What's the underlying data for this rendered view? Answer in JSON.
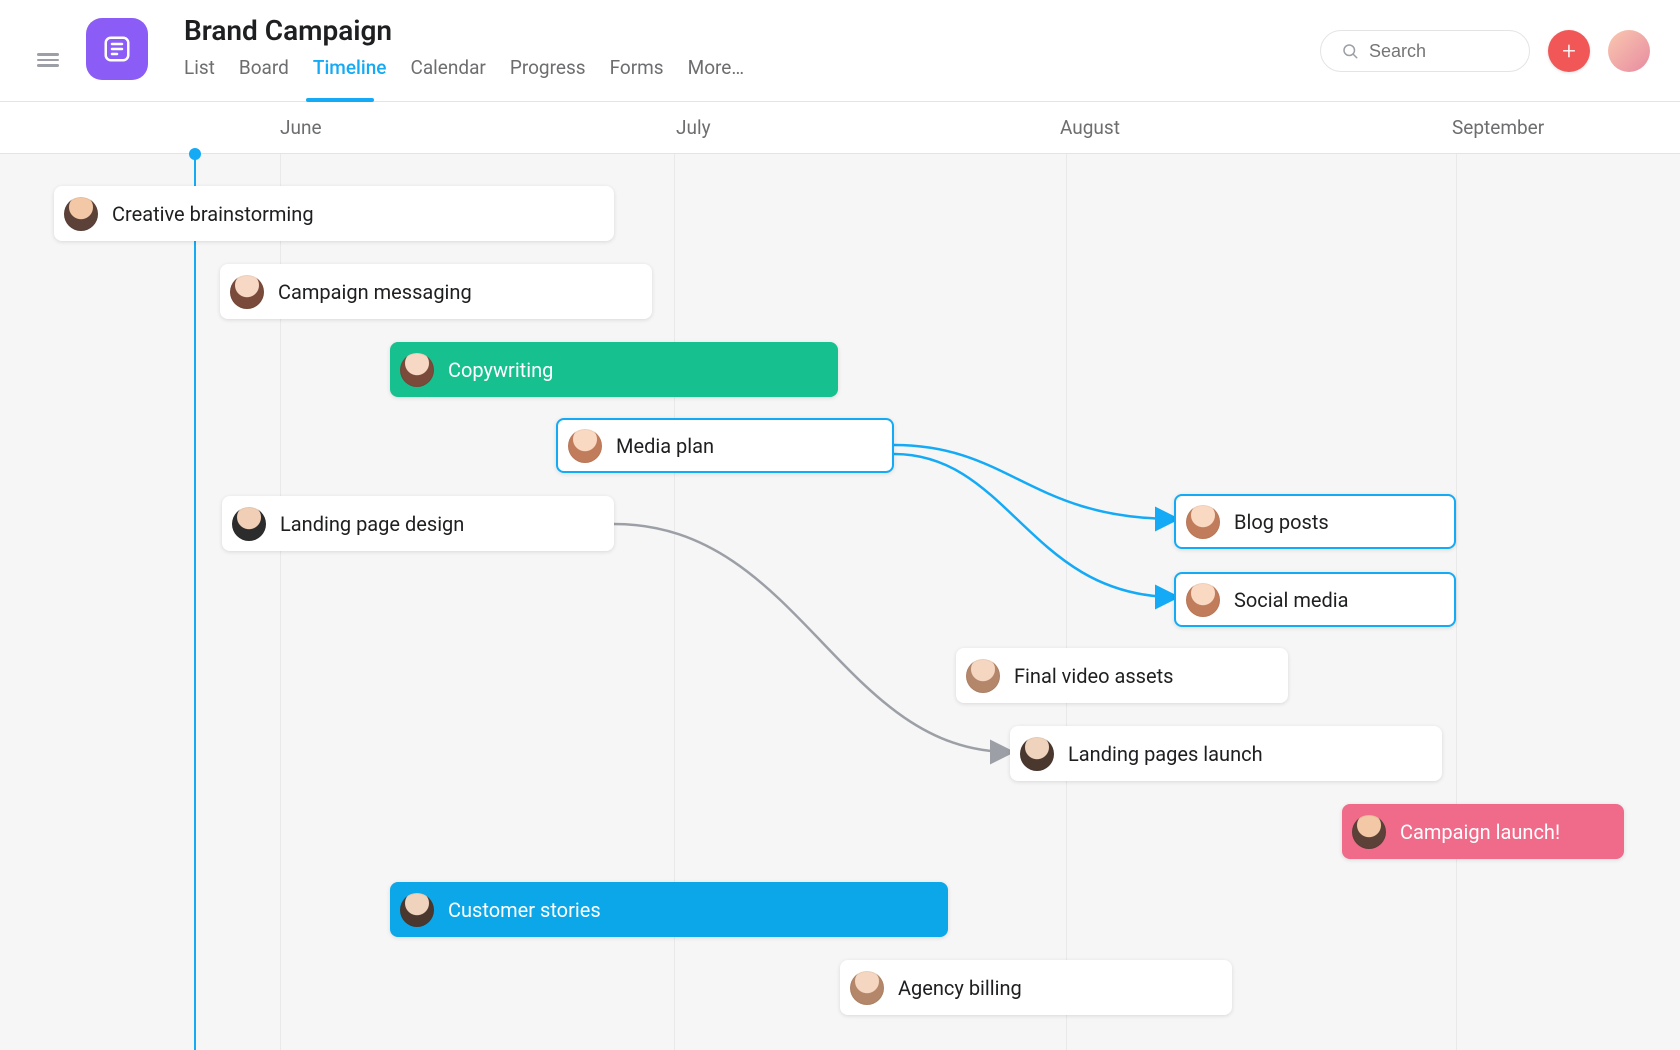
{
  "project": {
    "title": "Brand Campaign"
  },
  "search": {
    "placeholder": "Search"
  },
  "tabs": [
    {
      "label": "List"
    },
    {
      "label": "Board"
    },
    {
      "label": "Timeline"
    },
    {
      "label": "Calendar"
    },
    {
      "label": "Progress"
    },
    {
      "label": "Forms"
    },
    {
      "label": "More…"
    }
  ],
  "months": {
    "june": "June",
    "july": "July",
    "august": "August",
    "september": "September"
  },
  "tasks": {
    "creative": "Creative brainstorming",
    "messaging": "Campaign messaging",
    "copy": "Copywriting",
    "media": "Media plan",
    "landing_design": "Landing page design",
    "blog": "Blog posts",
    "social": "Social media",
    "video": "Final video assets",
    "landing_launch": "Landing pages launch",
    "campaign": "Campaign launch!",
    "stories": "Customer stories",
    "billing": "Agency billing"
  },
  "colors": {
    "accent": "#14aaf5",
    "green": "#17c08f",
    "blue": "#0ca7e8",
    "pink": "#f06a8a",
    "purple": "#8b5cf6"
  }
}
